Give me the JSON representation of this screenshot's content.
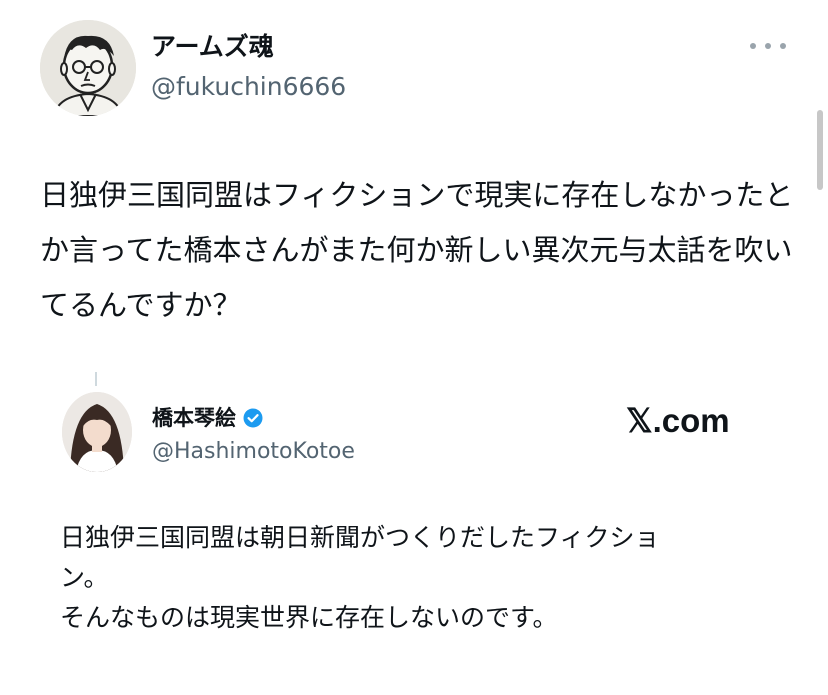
{
  "tweet": {
    "author": {
      "display_name": "アームズ魂",
      "handle": "@fukuchin6666",
      "avatar": "cartoon-face-avatar"
    },
    "more_icon": "more-horizontal-icon",
    "text": "日独伊三国同盟はフィクションで現実に存在しなかったとか言ってた橋本さんがまた何か新しい異次元与太話を吹いてるんですか？"
  },
  "quoted": {
    "author": {
      "display_name": "橋本琴絵",
      "handle": "@HashimotoKotoe",
      "verified_icon": "verified-badge-icon",
      "verified_color": "#1d9bf0",
      "avatar": "portrait-photo-avatar"
    },
    "source": "𝕏.com",
    "lines": [
      "日独伊三国同盟は朝日新聞がつくりだしたフィクショ",
      "ン。",
      "そんなものは現実世界に存在しないのです。"
    ]
  }
}
